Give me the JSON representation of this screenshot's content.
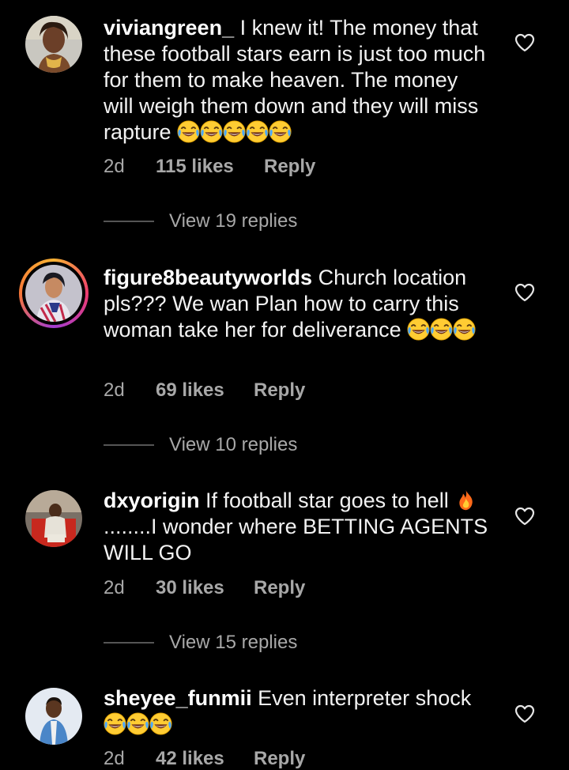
{
  "comments": [
    {
      "username": "viviangreen_",
      "text": " I knew it! The money that these football stars earn is just too much for them to make heaven. The money will weigh them down and they will miss rapture ",
      "emoji_count": 5,
      "time": "2d",
      "likes": "115 likes",
      "reply": "Reply",
      "view_replies": "View 19 replies"
    },
    {
      "username": "figure8beautyworlds",
      "text": " Church location pls??? We wan Plan how to carry this woman take her for deliverance ",
      "emoji_count": 3,
      "time": "2d",
      "likes": "69 likes",
      "reply": "Reply",
      "view_replies": "View 10 replies"
    },
    {
      "username": "dxyorigin",
      "text_before": " If football star goes to hell ",
      "text_after": "........I wonder where BETTING AGENTS WILL GO",
      "time": "2d",
      "likes": "30 likes",
      "reply": "Reply",
      "view_replies": "View 15 replies"
    },
    {
      "username": "sheyee_funmii",
      "text": " Even interpreter shock ",
      "emoji_count": 3,
      "time": "2d",
      "likes": "42 likes",
      "reply": "Reply"
    }
  ],
  "icons": {
    "like": "heart-outline-icon",
    "laugh": "face-with-tears-of-joy-emoji",
    "fire": "fire-emoji"
  },
  "colors": {
    "background": "#000000",
    "meta_text": "#a8a8a8",
    "story_ring_start": "#f9b233",
    "story_ring_end": "#ee3b6f"
  }
}
